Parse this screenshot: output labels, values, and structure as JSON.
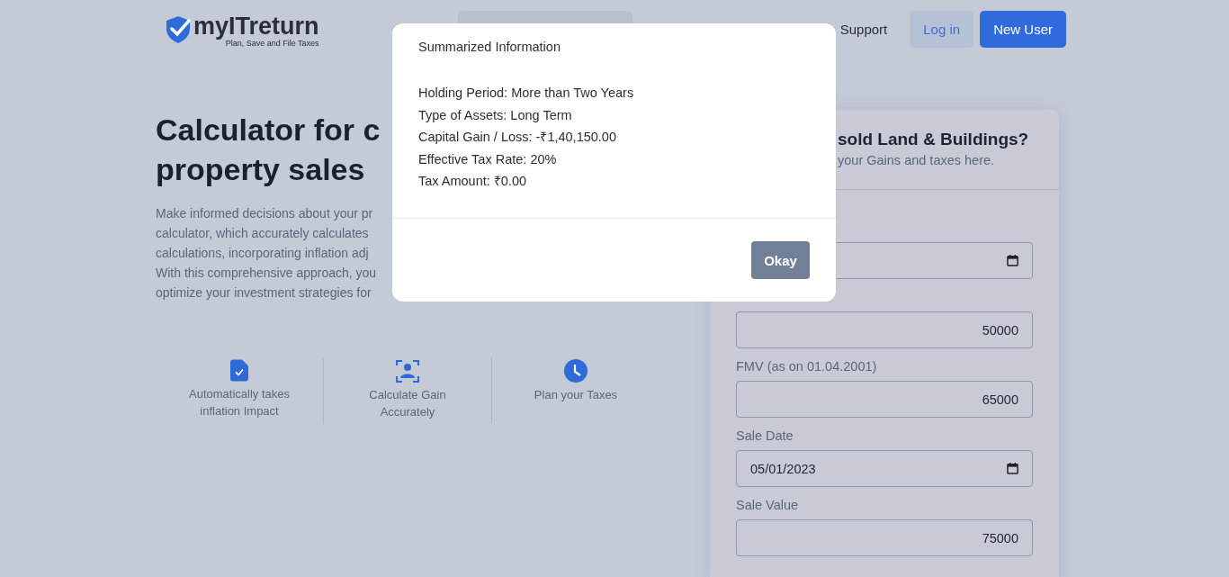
{
  "header": {
    "logo": {
      "name": "myITreturn",
      "tagline": "Plan, Save and File Taxes"
    },
    "nav": [
      {
        "label": "Support"
      }
    ],
    "buttons": [
      {
        "label": "Log in",
        "kind": "secondary"
      },
      {
        "label": "New User",
        "kind": "primary"
      }
    ]
  },
  "hero": {
    "title_lines": [
      "Calculator for c",
      "property sales"
    ],
    "paragraph_lines": [
      "Make informed decisions about your pr",
      "calculator, which accurately calculates",
      "calculations, incorporating inflation adj",
      "With this comprehensive approach, you",
      "optimize your investment strategies for"
    ]
  },
  "features": [
    {
      "kind": "document",
      "lines": [
        "Automatically takes",
        "inflation Impact"
      ]
    },
    {
      "kind": "person",
      "lines": [
        "Calculate Gain",
        "Accurately"
      ]
    },
    {
      "kind": "clock",
      "lines": [
        "Plan your Taxes"
      ]
    }
  ],
  "card": {
    "title": "sold Land & Buildings?",
    "subtitle": "your Gains and taxes here.",
    "fields": [
      {
        "kind": "date"
      },
      {
        "kind": "number",
        "value": "50000"
      },
      {
        "kind": "number",
        "label": "FMV (as on 01.04.2001)",
        "value": "65000"
      },
      {
        "kind": "date",
        "label": "Sale Date",
        "value": "05/01/2023"
      },
      {
        "kind": "number",
        "label": "Sale Value",
        "value": "75000"
      }
    ]
  },
  "modal": {
    "title": "Summarized Information",
    "lines": [
      "Holding Period: More than Two Years",
      "Type of Assets: Long Term",
      "Capital Gain / Loss: -₹1,40,150.00",
      "Effective Tax Rate: 20%",
      "Tax Amount: ₹0.00"
    ],
    "button": "Okay"
  }
}
